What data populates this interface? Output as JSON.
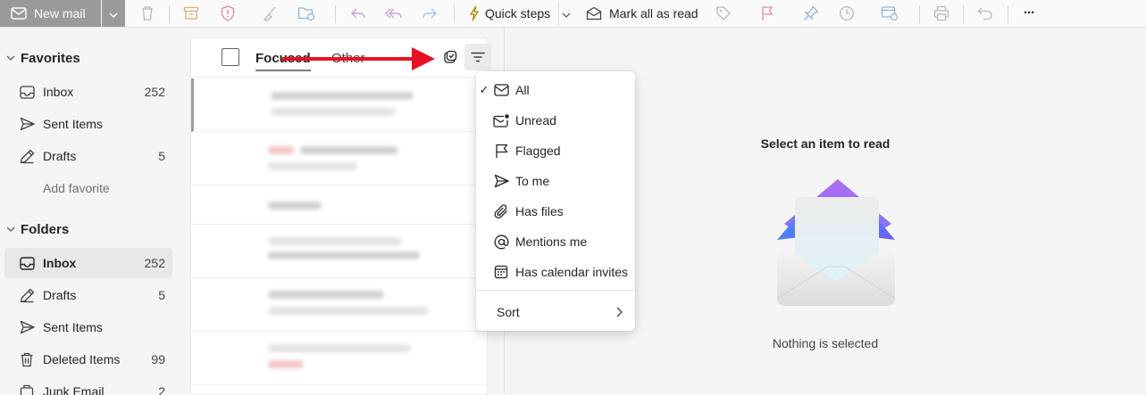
{
  "toolbar": {
    "new_mail_label": "New mail",
    "quick_steps_label": "Quick steps",
    "mark_all_read_label": "Mark all as read",
    "more_label": "···"
  },
  "nav": {
    "favorites_heading": "Favorites",
    "favorites": [
      {
        "label": "Inbox",
        "count": "252",
        "icon": "inbox-icon"
      },
      {
        "label": "Sent Items",
        "count": "",
        "icon": "send-icon"
      },
      {
        "label": "Drafts",
        "count": "5",
        "icon": "pencil-icon"
      }
    ],
    "add_favorite_label": "Add favorite",
    "folders_heading": "Folders",
    "folders": [
      {
        "label": "Inbox",
        "count": "252",
        "icon": "inbox-icon"
      },
      {
        "label": "Drafts",
        "count": "5",
        "icon": "pencil-icon"
      },
      {
        "label": "Sent Items",
        "count": "",
        "icon": "send-icon"
      },
      {
        "label": "Deleted Items",
        "count": "99",
        "icon": "trash-icon"
      },
      {
        "label": "Junk Email",
        "count": "2",
        "icon": "junk-icon"
      }
    ]
  },
  "list": {
    "tab_focused": "Focused",
    "tab_other": "Other"
  },
  "filter_menu": {
    "items": [
      {
        "label": "All",
        "icon": "mail-icon",
        "checked": true
      },
      {
        "label": "Unread",
        "icon": "mail-unread-icon",
        "checked": false
      },
      {
        "label": "Flagged",
        "icon": "flag-icon",
        "checked": false
      },
      {
        "label": "To me",
        "icon": "send-icon",
        "checked": false
      },
      {
        "label": "Has files",
        "icon": "paperclip-icon",
        "checked": false
      },
      {
        "label": "Mentions me",
        "icon": "at-icon",
        "checked": false
      },
      {
        "label": "Has calendar invites",
        "icon": "calendar-icon",
        "checked": false
      }
    ],
    "check_mark": "✓",
    "sort_label": "Sort"
  },
  "reading_pane": {
    "title": "Select an item to read",
    "subtitle": "Nothing is selected"
  },
  "colors": {
    "annotation_arrow": "#e81123",
    "new_mail_bg": "#9a9a9a"
  }
}
